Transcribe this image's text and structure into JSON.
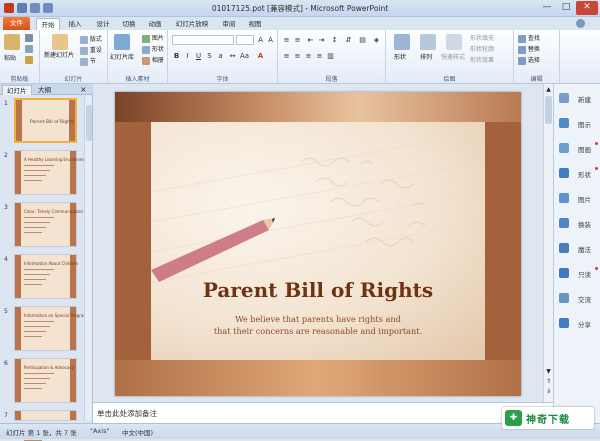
{
  "window": {
    "title": "01017125.pot [兼容模式] - Microsoft PowerPoint",
    "minimize": "—",
    "maximize": "□",
    "close": "✕"
  },
  "tabs": [
    "开始",
    "插入",
    "设计",
    "切换",
    "动画",
    "幻灯片放映",
    "审阅",
    "视图"
  ],
  "file_tab": "文件",
  "ribbon": {
    "clipboard": {
      "label": "剪贴板",
      "paste": "粘贴"
    },
    "slides": {
      "label": "幻灯片",
      "new_slide": "新建幻灯片",
      "layout": "版式",
      "reset": "重设",
      "section": "节"
    },
    "images": {
      "label": "插入素材",
      "library": "幻灯片库",
      "picture": "图片",
      "shape": "形状",
      "album": "相册"
    },
    "font": {
      "label": "字体",
      "font_name": "",
      "font_size": ""
    },
    "paragraph": {
      "label": "段落"
    },
    "drawing": {
      "label": "绘图",
      "shape": "形状",
      "arrange": "排列",
      "quick_styles": "快速样式",
      "fill": "形状填充",
      "outline": "形状轮廓",
      "effects": "形状效果"
    },
    "editing": {
      "label": "编辑",
      "find": "查找",
      "replace": "替换",
      "select": "选择"
    }
  },
  "left_pane": {
    "tabs": [
      "幻灯片",
      "大纲"
    ],
    "thumbnails": [
      {
        "num": "1",
        "title": "Parent Bill of Rights"
      },
      {
        "num": "2",
        "title": "A Healthy Learning Environment"
      },
      {
        "num": "3",
        "title": "Clear, Timely Communication"
      },
      {
        "num": "4",
        "title": "Information About Children"
      },
      {
        "num": "5",
        "title": "Information on Special Programs"
      },
      {
        "num": "6",
        "title": "Participation & Advocacy"
      },
      {
        "num": "7",
        "title": ""
      }
    ]
  },
  "slide": {
    "title": "Parent Bill of Rights",
    "subtitle_line1": "We believe that parents have rights and",
    "subtitle_line2": "that their concerns are reasonable and important."
  },
  "notes": {
    "placeholder": "单击此处添加备注"
  },
  "right_panel": {
    "items": [
      "新建",
      "图示",
      "图画",
      "形状",
      "图片",
      "换装",
      "魔法",
      "只读",
      "交流",
      "分享"
    ]
  },
  "status": {
    "slide_info": "幻灯片 第 1 张，共 7 张",
    "theme": "\"Axis\"",
    "language": "中文(中国)"
  },
  "watermark": {
    "text": "神奇下载"
  },
  "colors": {
    "accent": "#d8521a",
    "slide_frame": "#a4623c",
    "title_color": "#6c3410"
  }
}
